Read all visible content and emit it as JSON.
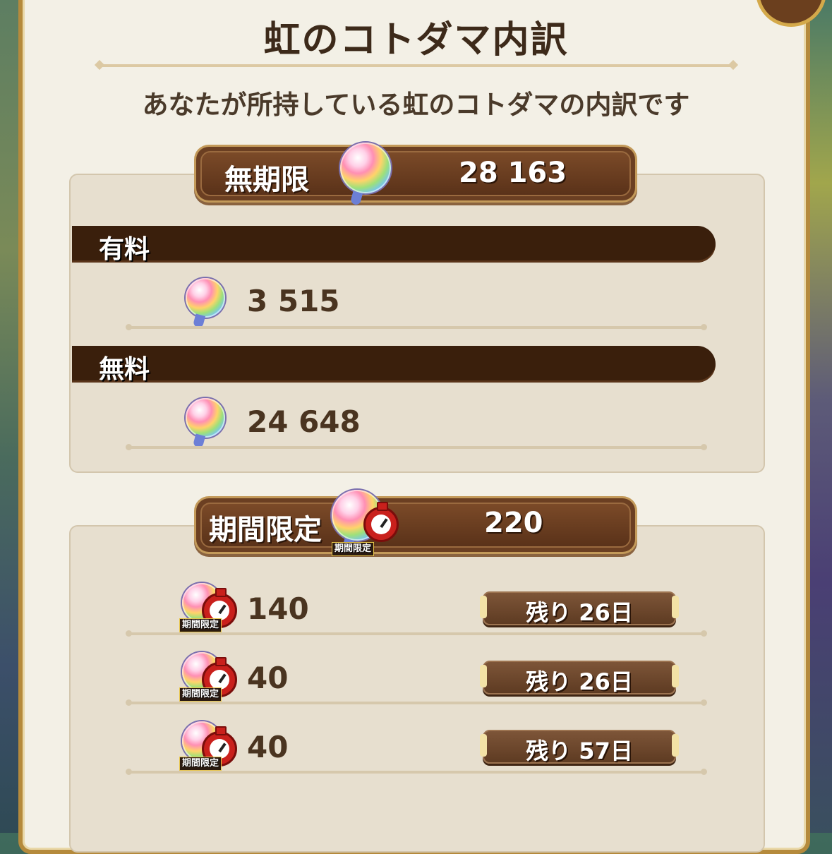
{
  "title": "虹のコトダマ内訳",
  "subtitle": "あなたが所持している虹のコトダマの内訳です",
  "unlimited": {
    "label": "無期限",
    "total": "28 163",
    "paid_label": "有料",
    "paid_value": "3 515",
    "free_label": "無料",
    "free_value": "24 648"
  },
  "limited": {
    "label": "期間限定",
    "total": "220",
    "badge": "期間限定",
    "rows": [
      {
        "value": "140",
        "remaining": "残り 26日",
        "badge": "期間限定"
      },
      {
        "value": "40",
        "remaining": "残り 26日",
        "badge": "期間限定"
      },
      {
        "value": "40",
        "remaining": "残り 57日",
        "badge": "期間限定"
      }
    ]
  },
  "icons": {
    "orb": "rainbow-kotodama-icon",
    "timer": "stopwatch-icon"
  }
}
